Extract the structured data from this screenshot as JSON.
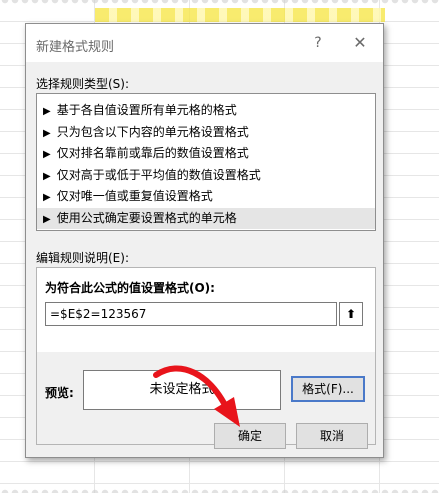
{
  "dialog": {
    "title": "新建格式规则",
    "help": "?",
    "close": "✕",
    "select_rule_type_label": "选择规则类型(S):",
    "rule_types": [
      "基于各自值设置所有单元格的格式",
      "只为包含以下内容的单元格设置格式",
      "仅对排名靠前或靠后的数值设置格式",
      "仅对高于或低于平均值的数值设置格式",
      "仅对唯一值或重复值设置格式",
      "使用公式确定要设置格式的单元格"
    ],
    "selected_rule_index": 5,
    "edit_rule_label": "编辑规则说明(E):",
    "formula_label": "为符合此公式的值设置格式(O):",
    "formula_value": "=$E$2=123567",
    "collapse_icon_glyph": "⬆",
    "preview_label": "预览:",
    "preview_text": "未设定格式",
    "format_button": "格式(F)...",
    "ok_button": "确定",
    "cancel_button": "取消"
  },
  "colors": {
    "dialog_bg": "#f0f0f0",
    "selected_row": "#e5e5e5",
    "annotation_arrow": "#e8141b",
    "format_button_border": "#4a79c9"
  }
}
